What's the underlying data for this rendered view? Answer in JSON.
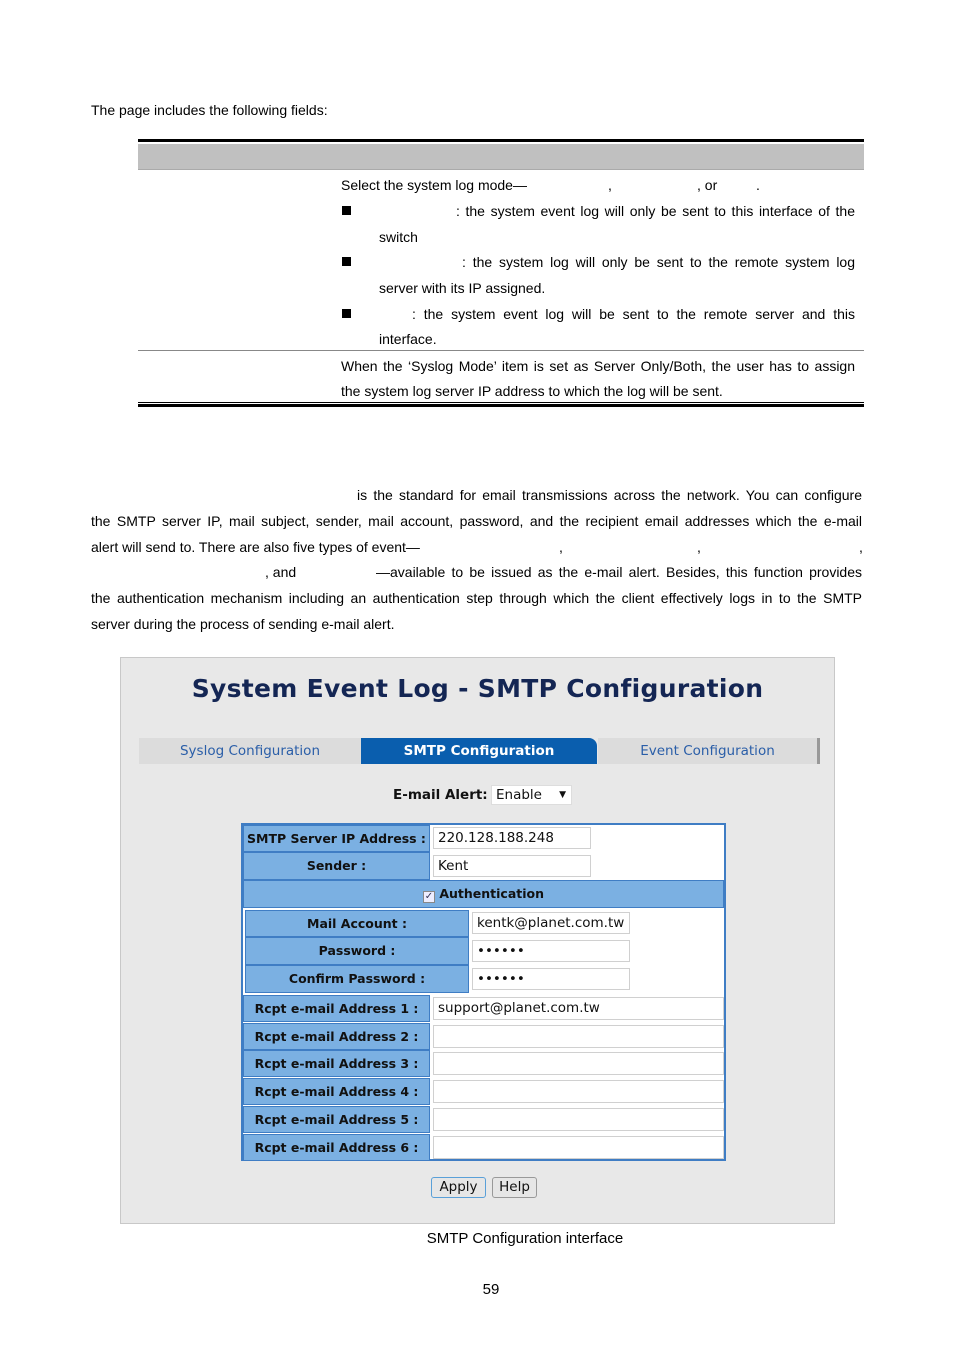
{
  "intro": "The page includes the following fields:",
  "table": {
    "mode_line": [
      "Select the system log mode—",
      ",",
      ", or",
      "."
    ],
    "bullets": [
      {
        "text": ": the system event log will only be sent to this interface of the",
        "cont": "switch"
      },
      {
        "text": ": the system log will only be sent to the remote system log",
        "cont": "server with its IP assigned."
      },
      {
        "text": ": the system event log will be sent to the remote server and this",
        "cont": "interface."
      }
    ],
    "row2": [
      "When the ‘Syslog Mode’ item is set as Server Only/Both, the user has to assign",
      "the system log server IP address to which the log will be sent."
    ]
  },
  "paragraph": {
    "l1": "is the standard for email transmissions across the network. You can configure",
    "l2": "the SMTP server IP, mail subject, sender, mail account, password, and the recipient email addresses which the e-mail",
    "l3": "alert will send to. There are also five types of event—",
    "comma": ",",
    "l4a": ", and",
    "l4b": "—available to be issued as the e-mail alert. Besides, this function provides",
    "l5": "the authentication mechanism including an authentication step through which the client effectively logs in to the SMTP",
    "l6": "server during the process of sending e-mail alert."
  },
  "ui": {
    "title": "System Event Log - SMTP Configuration",
    "tabs": [
      "Syslog Configuration",
      "SMTP Configuration",
      "Event Configuration"
    ],
    "active_tab": 1,
    "email_alert_label": "E-mail Alert:",
    "email_alert_value": "Enable",
    "smtp_ip_label": "SMTP Server IP Address :",
    "smtp_ip": "220.128.188.248",
    "sender_label": "Sender :",
    "sender": "Kent",
    "auth_label": "Authentication",
    "auth_checked": true,
    "mail_account_label": "Mail Account :",
    "mail_account": "kentk@planet.com.tw",
    "password_label": "Password :",
    "password": "••••••",
    "confirm_label": "Confirm Password :",
    "confirm": "••••••",
    "rcpt": [
      {
        "label": "Rcpt e-mail Address 1 :",
        "value": "support@planet.com.tw"
      },
      {
        "label": "Rcpt e-mail Address 2 :",
        "value": ""
      },
      {
        "label": "Rcpt e-mail Address 3 :",
        "value": ""
      },
      {
        "label": "Rcpt e-mail Address 4 :",
        "value": ""
      },
      {
        "label": "Rcpt e-mail Address 5 :",
        "value": ""
      },
      {
        "label": "Rcpt e-mail Address 6 :",
        "value": ""
      }
    ],
    "apply": "Apply",
    "help": "Help",
    "colors": {
      "active_tab": "#0a5eae",
      "label_cell": "#7bb0e2",
      "border": "#3f7dc4",
      "title": "#142654"
    }
  },
  "caption": "SMTP Configuration interface",
  "page_number": "59"
}
